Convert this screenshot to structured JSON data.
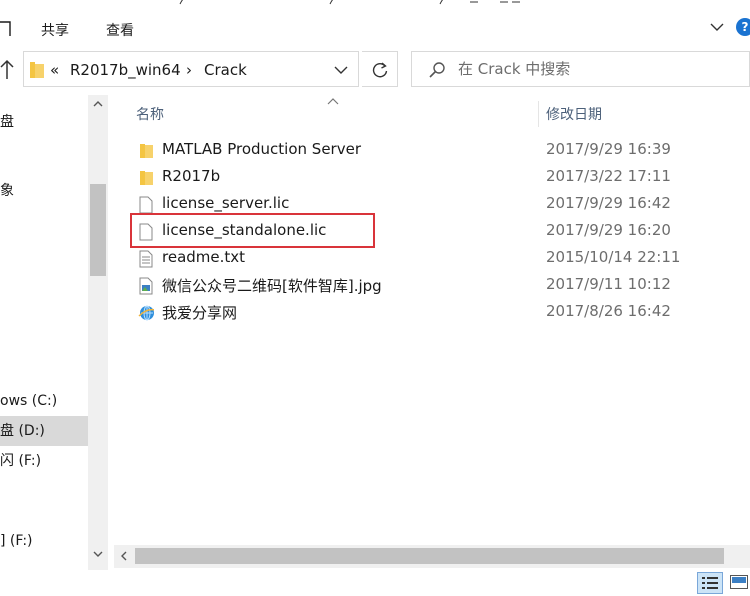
{
  "ribbon": {
    "tabs": [
      "共享",
      "查看"
    ],
    "help_label": "?"
  },
  "address": {
    "overflow": "«",
    "segments": [
      "R2017b_win64",
      "Crack"
    ],
    "separator": "›"
  },
  "search": {
    "placeholder": "在 Crack 中搜索"
  },
  "nav": {
    "items": [
      {
        "label": "盘",
        "selected": false
      },
      {
        "label": "象",
        "selected": false
      },
      {
        "label": "ows (C:)",
        "selected": false
      },
      {
        "label": "盘 (D:)",
        "selected": true
      },
      {
        "label": "闪 (F:)",
        "selected": false
      },
      {
        "label": "] (F:)",
        "selected": false
      }
    ]
  },
  "columns": {
    "name": "名称",
    "date": "修改日期"
  },
  "files": [
    {
      "name": "MATLAB Production Server",
      "date": "2017/9/29 16:39",
      "icon": "folder-icon"
    },
    {
      "name": "R2017b",
      "date": "2017/3/22 17:11",
      "icon": "folder-icon"
    },
    {
      "name": "license_server.lic",
      "date": "2017/9/29 16:42",
      "icon": "file-icon"
    },
    {
      "name": "license_standalone.lic",
      "date": "2017/9/29 16:20",
      "icon": "file-icon"
    },
    {
      "name": "readme.txt",
      "date": "2015/10/14 22:11",
      "icon": "text-file-icon"
    },
    {
      "name": "微信公众号二维码[软件智库].jpg",
      "date": "2017/9/11 10:12",
      "icon": "image-file-icon"
    },
    {
      "name": "我爱分享网",
      "date": "2017/8/26 16:42",
      "icon": "internet-shortcut-icon"
    }
  ],
  "colors": {
    "highlight_box": "#d9343a",
    "selection": "#cce8ff",
    "folder": "#f4c542"
  }
}
